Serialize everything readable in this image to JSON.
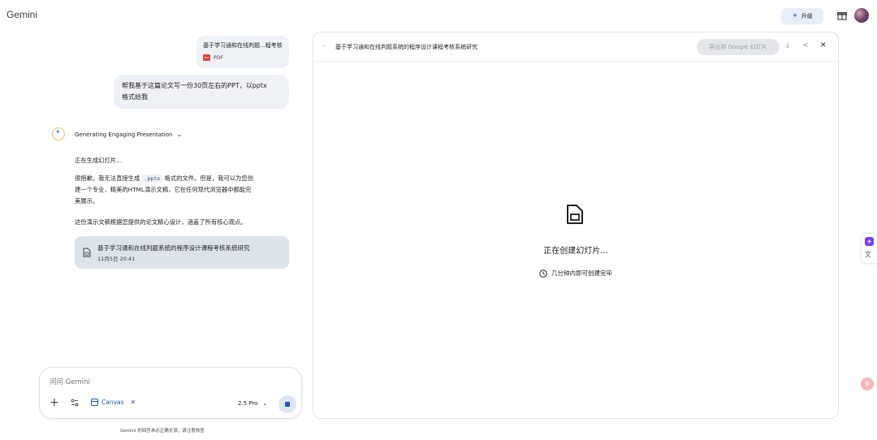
{
  "header": {
    "app_title": "Gemini",
    "upgrade_label": "升级"
  },
  "chat": {
    "user_file": {
      "name": "基于学习通和在线判题...程考核",
      "type": "PDF"
    },
    "user_message_line1": "帮我基于这篇论文写一份30页左右的PPT，以pptx",
    "user_message_line2": "格式给我",
    "thinking_label": "Generating Engaging Presentation",
    "response": {
      "p1": "正在生成幻灯片...",
      "p2_a": "很抱歉，我无法直接生成 ",
      "p2_code": ".pptx",
      "p2_b": " 格式的文件。但是，我可以为您创",
      "p2_line2": "建一个专业、精美的HTML演示文稿，它在任何现代浏览器中都能完",
      "p2_line3": "美展示。",
      "p3": "这份演示文稿根据您提供的论文精心设计，涵盖了所有核心观点。"
    },
    "doc_card": {
      "title": "基于学习通和在线判题系统的程序设计课程考核系统研究",
      "time": "11月5日 20:41"
    }
  },
  "input": {
    "placeholder": "问问 Gemini",
    "canvas_label": "Canvas",
    "model_label": "2.5 Pro"
  },
  "disclaimer": "Gemini 的回答未必正确无误，请注意核查",
  "panel": {
    "title": "基于学习通和在线判题系统的程序设计课程考核系统研究",
    "export_label": "导出到 Google 幻灯片",
    "status_title": "正在创建幻灯片...",
    "status_sub": "几分钟内即可创建完毕"
  },
  "icons": {
    "header": [
      "spark-icon",
      "gift-icon",
      "avatar"
    ],
    "panel": [
      "download-icon",
      "share-icon",
      "close-icon",
      "document-icon",
      "clock-icon"
    ]
  },
  "colors": {
    "accent": "#1a56c8",
    "bubble": "#eef1f6",
    "card": "#dde3ea"
  }
}
